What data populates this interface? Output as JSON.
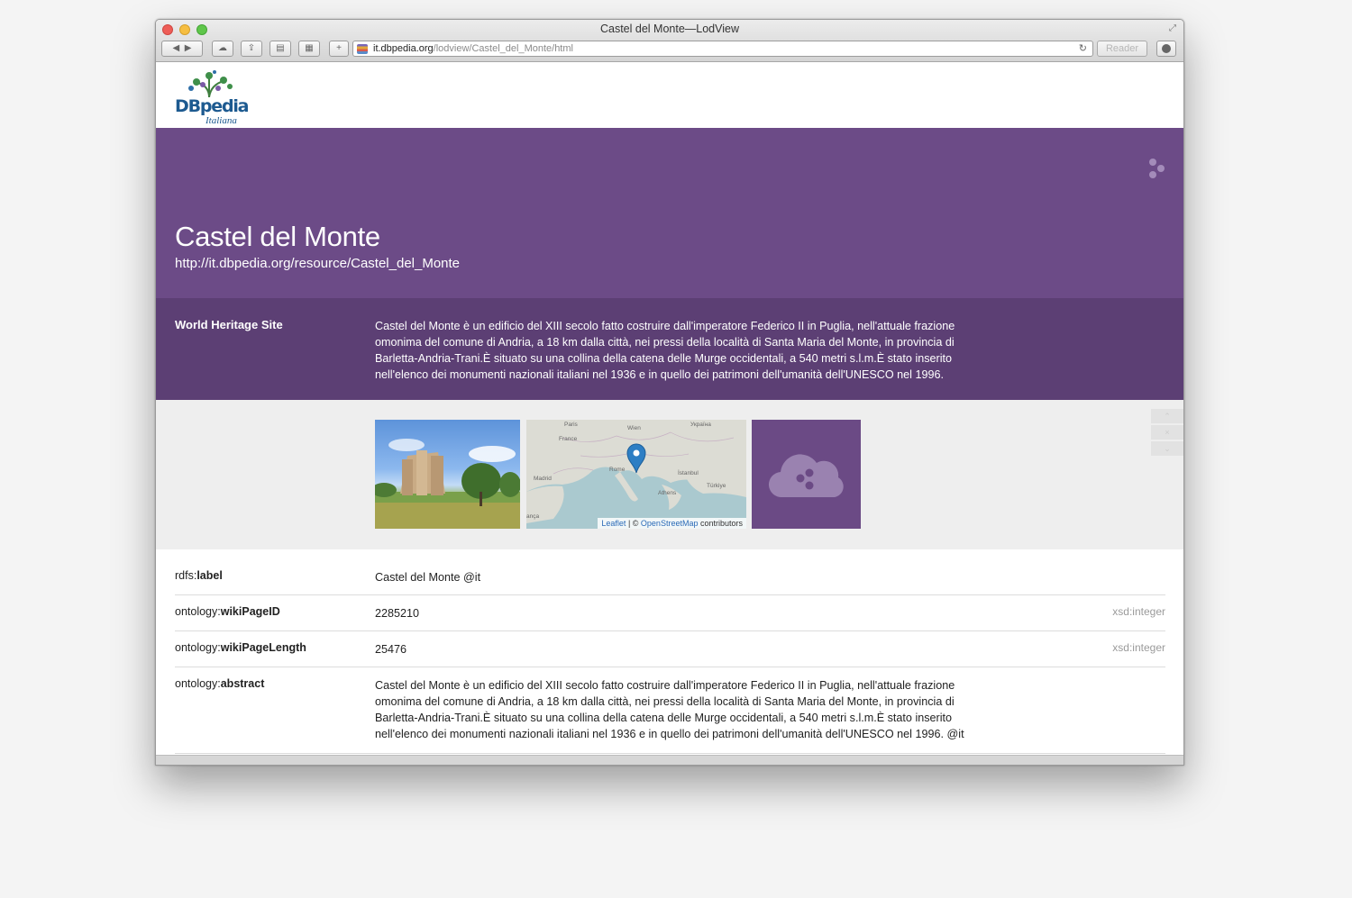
{
  "window": {
    "title": "Castel del Monte—LodView",
    "url_domain": "it.dbpedia.org",
    "url_path": "/lodview/Castel_del_Monte/html",
    "reader_label": "Reader"
  },
  "logo": {
    "word": "DBpedia",
    "sub": "Italiana"
  },
  "hero": {
    "title": "Castel del Monte",
    "uri": "http://it.dbpedia.org/resource/Castel_del_Monte"
  },
  "abstract_band": {
    "label": "World Heritage Site",
    "text": "Castel del Monte è un edificio del XIII secolo fatto costruire dall'imperatore Federico II in Puglia, nell'attuale frazione omonima del comune di Andria, a 18 km dalla città, nei pressi della località di Santa Maria del Monte, in provincia di Barletta-Andria-Trani.È situato su una collina della catena delle Murge occidentali, a 540 metri s.l.m.È stato inserito nell'elenco dei monumenti nazionali italiani nel 1936 e in quello dei patrimoni dell'umanità dell'UNESCO nel 1996."
  },
  "map": {
    "labels": [
      "Paris",
      "Wien",
      "Україна",
      "France",
      "Rome",
      "Madrid",
      "İstanbul",
      "Türkiye",
      "Athens",
      "ança"
    ],
    "attr_leaflet": "Leaflet",
    "attr_sep": " | © ",
    "attr_osm": "OpenStreetMap",
    "attr_rest": " contributors"
  },
  "properties": [
    {
      "prefix": "rdfs:",
      "name": "label",
      "value": "Castel del Monte @it",
      "type": ""
    },
    {
      "prefix": "ontology:",
      "name": "wikiPageID",
      "value": "2285210",
      "type": "xsd:integer"
    },
    {
      "prefix": "ontology:",
      "name": "wikiPageLength",
      "value": "25476",
      "type": "xsd:integer"
    },
    {
      "prefix": "ontology:",
      "name": "abstract",
      "value": "Castel del Monte è un edificio del XIII secolo fatto costruire dall'imperatore Federico II in Puglia, nell'attuale frazione omonima del comune di Andria, a 18 km dalla città, nei pressi della località di Santa Maria del Monte, in provincia di Barletta-Andria-Trani.È situato su una collina della catena delle Murge occidentali, a 540 metri s.l.m.È stato inserito nell'elenco dei monumenti nazionali italiani nel 1936 e in quello dei patrimoni dell'umanità dell'UNESCO nel 1996. @it",
      "type": ""
    }
  ],
  "colors": {
    "hero": "#6c4b87",
    "band": "#5c3f74",
    "link": "#2a6ab7"
  }
}
